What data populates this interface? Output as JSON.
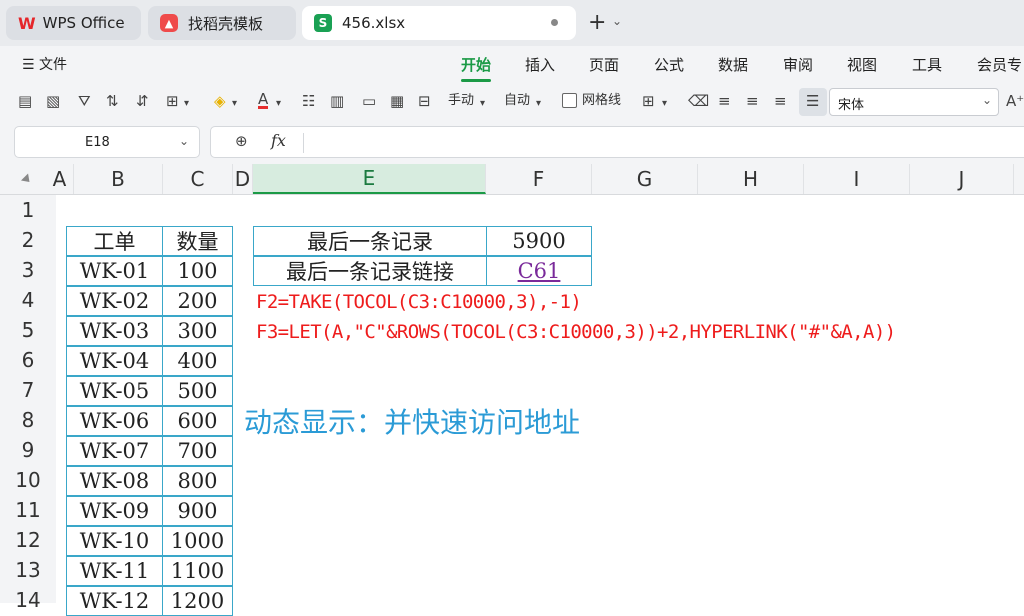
{
  "tabs": [
    {
      "label": "WPS Office",
      "icon": "wps-logo-icon"
    },
    {
      "label": "找稻壳模板",
      "icon": "docer-icon"
    },
    {
      "label": "456.xlsx",
      "icon": "spreadsheet-icon"
    }
  ],
  "menu": {
    "file_label": "文件",
    "items": [
      "开始",
      "插入",
      "页面",
      "公式",
      "数据",
      "审阅",
      "视图",
      "工具",
      "会员专"
    ],
    "active": "开始"
  },
  "toolbar": {
    "manual_label": "手动",
    "auto_label": "自动",
    "gridlines_label": "网格线",
    "font_name": "宋体"
  },
  "formula_bar": {
    "cell_ref": "E18",
    "fx_symbol": "fx"
  },
  "columns": [
    "A",
    "B",
    "C",
    "D",
    "E",
    "F",
    "G",
    "H",
    "I",
    "J"
  ],
  "selected_column": "E",
  "rows": [
    "1",
    "2",
    "3",
    "4",
    "5",
    "6",
    "7",
    "8",
    "9",
    "10",
    "11",
    "12",
    "13",
    "14"
  ],
  "table": {
    "headers": [
      "工单",
      "数量"
    ],
    "rows": [
      [
        "WK-01",
        "100"
      ],
      [
        "WK-02",
        "200"
      ],
      [
        "WK-03",
        "300"
      ],
      [
        "WK-04",
        "400"
      ],
      [
        "WK-05",
        "500"
      ],
      [
        "WK-06",
        "600"
      ],
      [
        "WK-07",
        "700"
      ],
      [
        "WK-08",
        "800"
      ],
      [
        "WK-09",
        "900"
      ],
      [
        "WK-10",
        "1000"
      ],
      [
        "WK-11",
        "1100"
      ],
      [
        "WK-12",
        "1200"
      ]
    ]
  },
  "summary": {
    "last_record_label": "最后一条记录",
    "last_record_value": "5900",
    "last_link_label": "最后一条记录链接",
    "last_link_value": "C61"
  },
  "formulas": {
    "f2": "F2=TAKE(TOCOL(C3:C10000,3),-1)",
    "f3": "F3=LET(A,\"C\"&ROWS(TOCOL(C3:C10000,3))+2,HYPERLINK(\"#\"&A,A))"
  },
  "caption": "动态显示：并快速访问地址",
  "colors": {
    "accent": "#1b9a46",
    "formula_text": "#ee1c1c",
    "caption_text": "#2b9bd6",
    "table_border": "#3aa7c9",
    "link": "#7a2a9a"
  }
}
